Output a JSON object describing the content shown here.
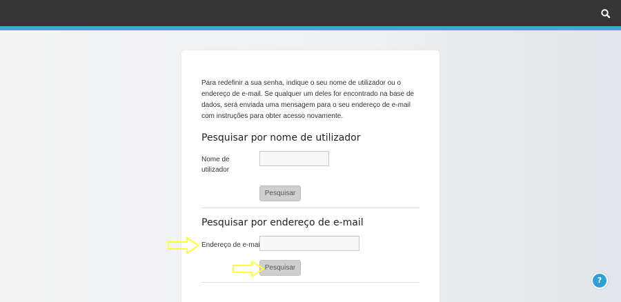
{
  "header": {
    "search_icon": "search-icon",
    "accent_color": "#3aa8d9",
    "bar_color": "#353535"
  },
  "form": {
    "intro_text": "Para redefinir a sua senha, indique o seu nome de utilizador ou o endereço de e-mail. Se qualquer um deles for encontrado na base de dados, será enviada uma mensagem para o seu endereço de e-mail com instruções para obter acesso novamente.",
    "username_section": {
      "title": "Pesquisar por nome de utilizador",
      "label": "Nome de utilizador",
      "value": "",
      "button_label": "Pesquisar"
    },
    "email_section": {
      "title": "Pesquisar por endereço de e-mail",
      "label": "Endereço de e-mail",
      "value": "",
      "button_label": "Pesquisar"
    }
  },
  "help": {
    "label": "?",
    "color": "#2f9fd8"
  },
  "annotations": {
    "arrow_color": "#ffff33"
  }
}
